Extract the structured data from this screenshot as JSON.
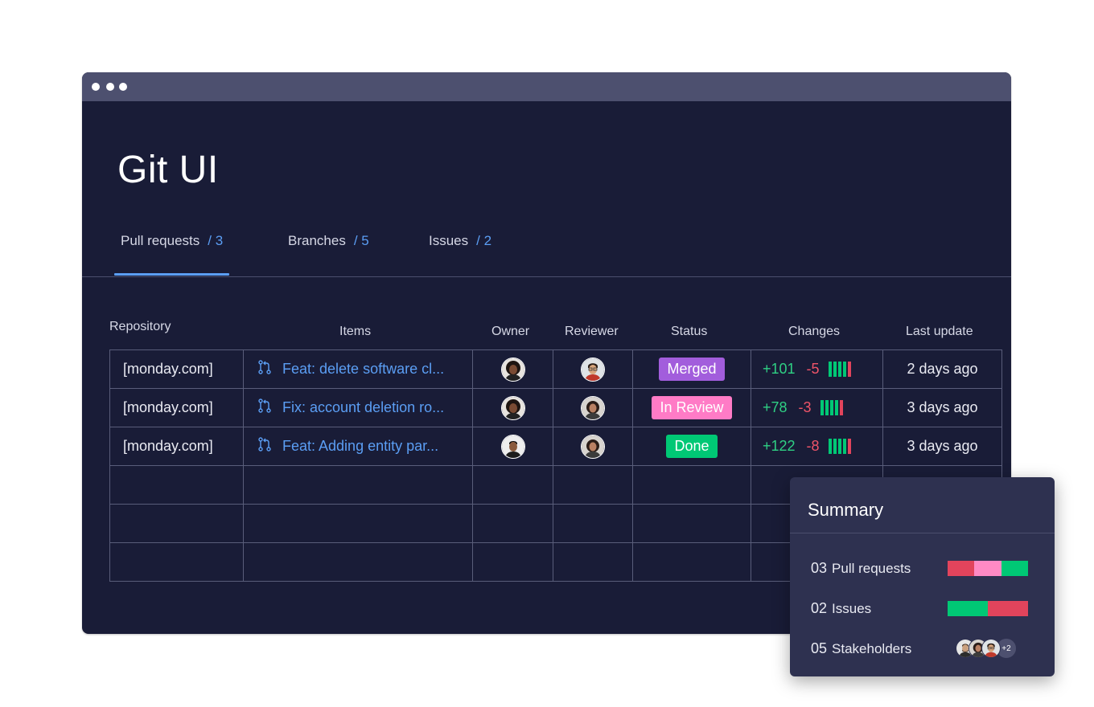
{
  "app": {
    "title": "Git UI"
  },
  "tabs": [
    {
      "label": "Pull requests",
      "count": "/ 3",
      "active": true
    },
    {
      "label": "Branches",
      "count": "/ 5",
      "active": false
    },
    {
      "label": "Issues",
      "count": "/ 2",
      "active": false
    }
  ],
  "columns": {
    "repository": "Repository",
    "items": "Items",
    "owner": "Owner",
    "reviewer": "Reviewer",
    "status": "Status",
    "changes": "Changes",
    "last_update": "Last update"
  },
  "rows": [
    {
      "repository": "[monday.com]",
      "item": "Feat: delete software cl...",
      "owner_avatar": "avatar-woman-curly-hair",
      "reviewer_avatar": "avatar-man-glasses",
      "status": "Merged",
      "status_color": "#a25ddc",
      "additions": "+101",
      "deletions": "-5",
      "bar_colors": [
        "#00c875",
        "#00c875",
        "#00c875",
        "#00c875",
        "#e2445c"
      ],
      "last_update": "2 days ago"
    },
    {
      "repository": "[monday.com]",
      "item": "Fix: account deletion ro...",
      "owner_avatar": "avatar-woman-curly-hair",
      "reviewer_avatar": "avatar-woman-dark-hair",
      "status": "In Review",
      "status_color": "#ff7bc6",
      "additions": "+78",
      "deletions": "-3",
      "bar_colors": [
        "#00c875",
        "#00c875",
        "#00c875",
        "#00c875",
        "#e2445c"
      ],
      "last_update": "3 days ago"
    },
    {
      "repository": "[monday.com]",
      "item": "Feat: Adding entity par...",
      "owner_avatar": "avatar-man-short-hair",
      "reviewer_avatar": "avatar-woman-dark-hair",
      "status": "Done",
      "status_color": "#00c875",
      "additions": "+122",
      "deletions": "-8",
      "bar_colors": [
        "#00c875",
        "#00c875",
        "#00c875",
        "#00c875",
        "#e2445c"
      ],
      "last_update": "3 days ago"
    }
  ],
  "empty_row_count": 3,
  "summary": {
    "title": "Summary",
    "pull_requests": {
      "count": "03",
      "label": "Pull requests",
      "segment_colors": [
        "#e2445c",
        "#ff8ac4",
        "#00c875"
      ]
    },
    "issues": {
      "count": "02",
      "label": "Issues",
      "segment_colors": [
        "#00c875",
        "#e2445c"
      ]
    },
    "stakeholders": {
      "count": "05",
      "label": "Stakeholders",
      "more": "+2",
      "avatars": [
        "avatar-man-beard",
        "avatar-woman-dark-hair",
        "avatar-man-glasses"
      ]
    }
  },
  "colors": {
    "window_bg": "#191c37",
    "titlebar": "#4d506f",
    "accent_blue": "#5b9ef4",
    "addition_green": "#2fd084",
    "deletion_red": "#f05469"
  }
}
